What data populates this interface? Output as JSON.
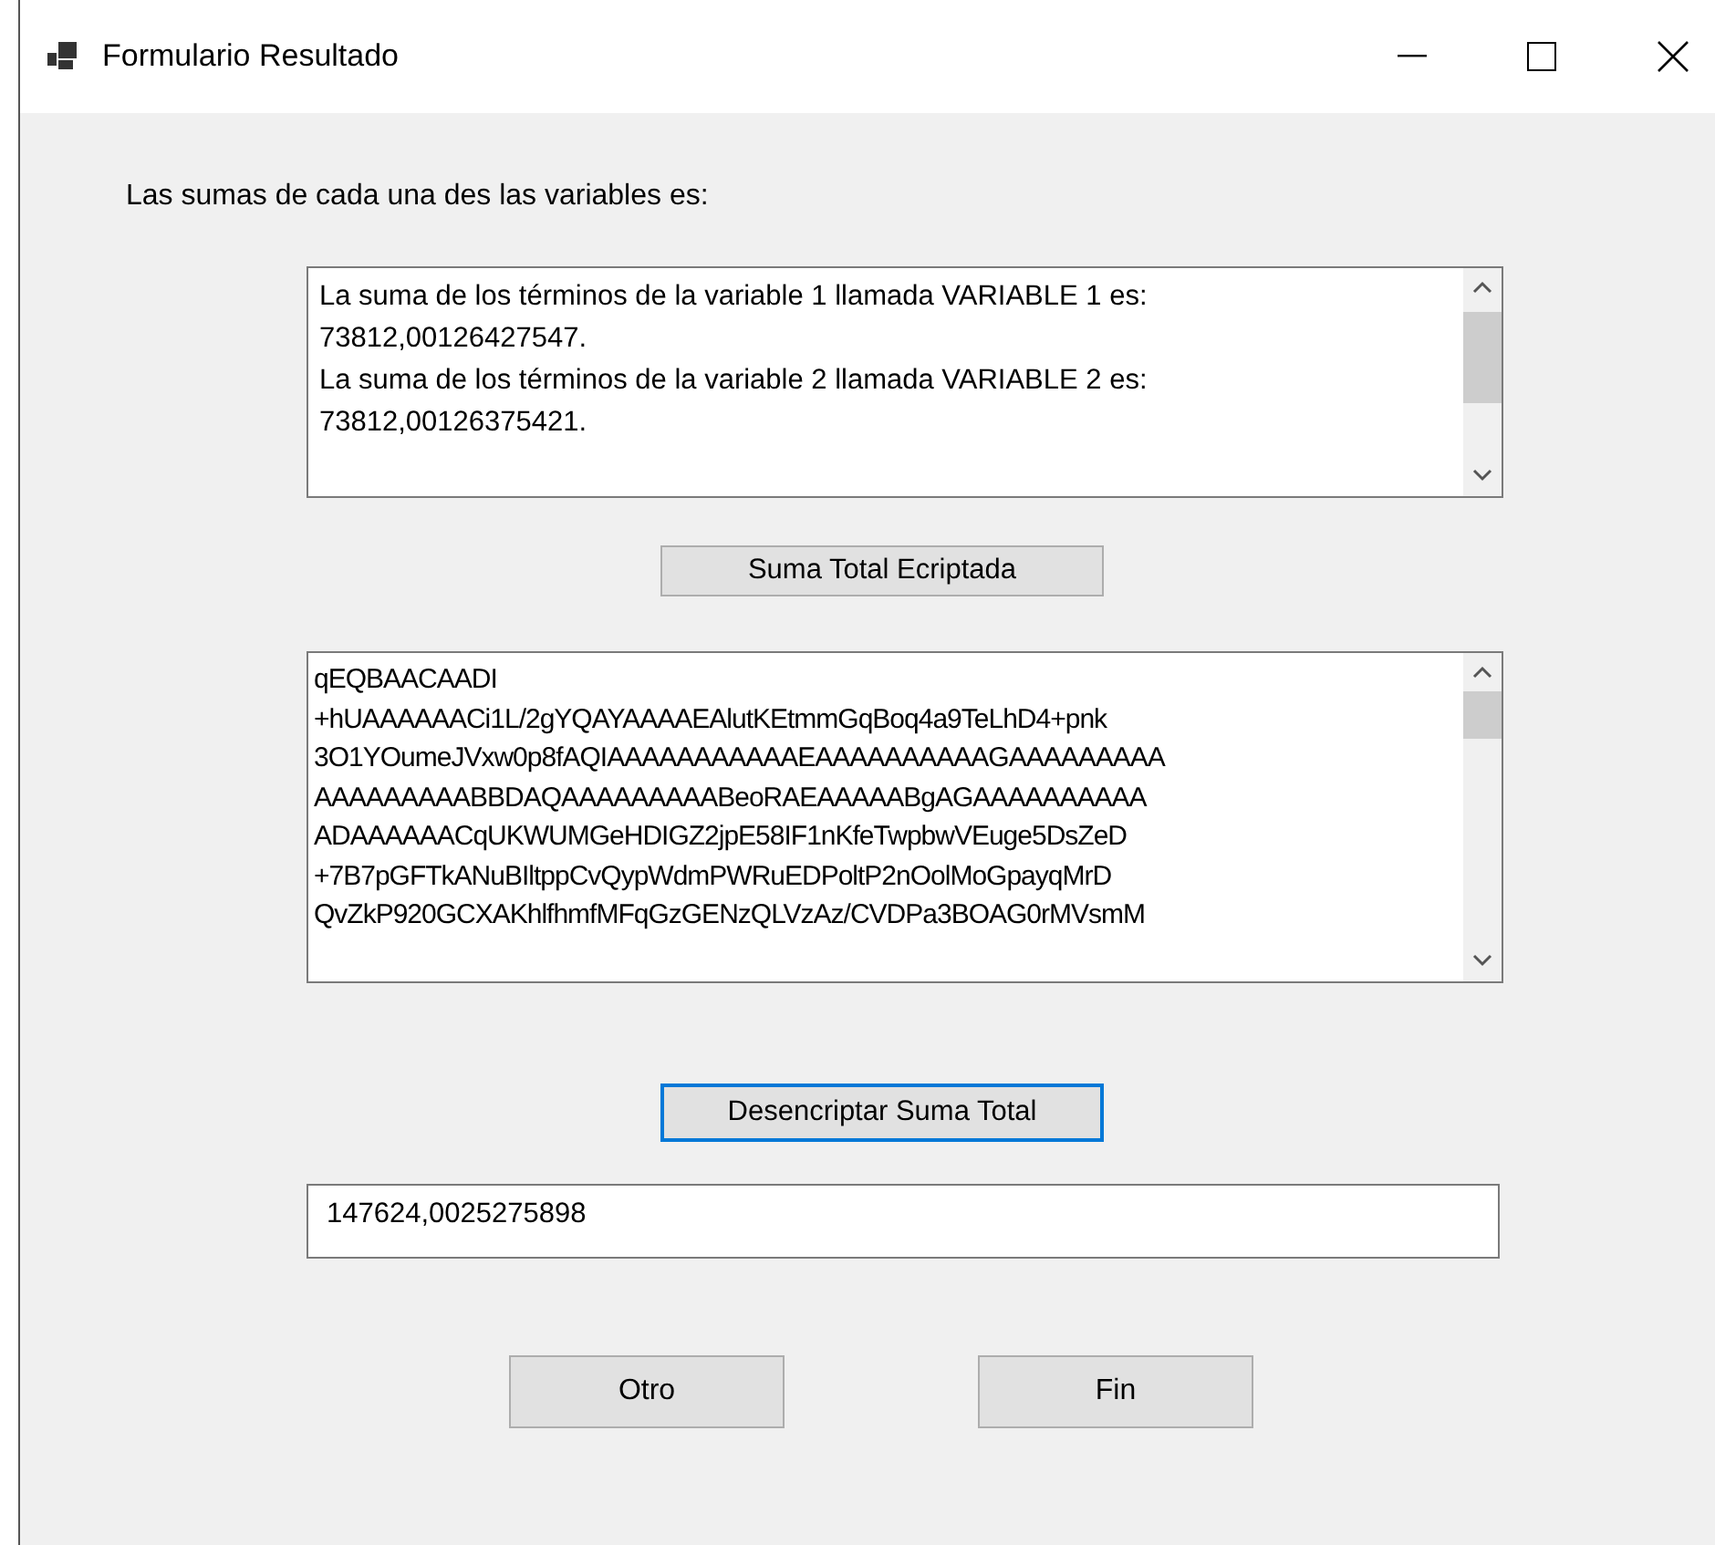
{
  "window": {
    "title": "Formulario Resultado"
  },
  "label": "Las sumas de cada una des las variables es:",
  "sums_box": {
    "lines": [
      "La suma de los términos de la variable 1 llamada VARIABLE 1 es:",
      "73812,00126427547.",
      "La suma de los términos de la variable 2 llamada VARIABLE 2 es:",
      "73812,00126375421."
    ]
  },
  "encrypt_button": {
    "label": "Suma Total Ecriptada",
    "focused": false
  },
  "encrypted_box": {
    "lines": [
      "qEQBAACAADI",
      "+hUAAAAAACi1L/2gYQAYAAAAEAlutKEtmmGqBoq4a9TeLhD4+pnk",
      "3O1YOumeJVxw0p8fAQIAAAAAAAAAAAEAAAAAAAAAAGAAAAAAAAA",
      "AAAAAAAAABBDAQAAAAAAAAABeoRAEAAAAABgAGAAAAAAAAAA",
      "ADAAAAAACqUKWUMGeHDIGZ2jpE58IF1nKfeTwpbwVEuge5DsZeD",
      "+7B7pGFTkANuBIltppCvQypWdmPWRuEDPoltP2nOolMoGpayqMrD",
      "QvZkP920GCXAKhlfhmfMFqGzGENzQLVzAz/CVDPa3BOAG0rMVsmM"
    ]
  },
  "decrypt_button": {
    "label": "Desencriptar Suma Total",
    "focused": true
  },
  "result_field": {
    "value": "147624,0025275898"
  },
  "buttons": [
    {
      "label": "Otro"
    },
    {
      "label": "Fin"
    }
  ]
}
